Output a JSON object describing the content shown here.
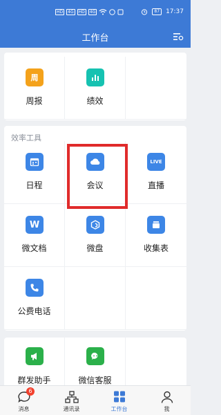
{
  "status_bar": {
    "left_chips": [
      "HD",
      "4G",
      "HD",
      "4G"
    ],
    "time": "17:37",
    "battery": "87"
  },
  "header": {
    "title": "工作台"
  },
  "top_card": {
    "items": [
      {
        "label": "周报",
        "icon": "weekly-report-icon",
        "color": "#f4a21b"
      },
      {
        "label": "绩效",
        "icon": "performance-chart-icon",
        "color": "#16c2b1"
      }
    ]
  },
  "efficiency_tools": {
    "title": "效率工具",
    "items": [
      {
        "label": "日程",
        "icon": "calendar-icon",
        "color": "#3d86e6"
      },
      {
        "label": "会议",
        "icon": "meeting-cloud-icon",
        "color": "#3d86e6"
      },
      {
        "label": "直播",
        "icon": "live-icon",
        "color": "#3d86e6",
        "glyph": "LIVE"
      },
      {
        "label": "微文档",
        "icon": "document-w-icon",
        "color": "#3d86e6",
        "glyph": "W"
      },
      {
        "label": "微盘",
        "icon": "drive-icon",
        "color": "#3d86e6"
      },
      {
        "label": "收集表",
        "icon": "form-collector-icon",
        "color": "#3d86e6"
      },
      {
        "label": "公费电话",
        "icon": "phone-icon",
        "color": "#3d86e6"
      }
    ]
  },
  "bottom_card": {
    "items": [
      {
        "label": "群发助手",
        "icon": "broadcast-icon",
        "color": "#2bb04a"
      },
      {
        "label": "微信客服",
        "icon": "wechat-service-icon",
        "color": "#2bb04a"
      }
    ]
  },
  "tab_bar": {
    "items": [
      {
        "label": "消息",
        "badge": "6"
      },
      {
        "label": "通讯录"
      },
      {
        "label": "工作台",
        "active": true
      },
      {
        "label": "我"
      }
    ]
  }
}
